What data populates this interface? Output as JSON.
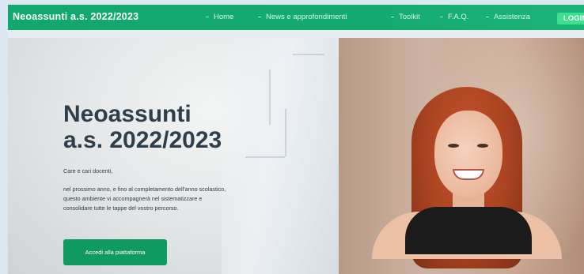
{
  "header": {
    "brand": "Neoassunti a.s. 2022/2023",
    "nav": [
      "Home",
      "News e approfondimenti",
      "Toolkit",
      "F.A.Q.",
      "Assistenza"
    ],
    "login_label": "LOGIN"
  },
  "hero": {
    "title_line1": "Neoassunti",
    "title_line2": "a.s. 2022/2023",
    "greeting": "Care e cari docenti,",
    "body_lines": [
      "nel prossimo anno, e fino al completamento dell'anno  scolastico,",
      "questo ambiente vi accompagnerà nel sistematizzare e",
      "consolidare tutte le tappe del vostro percorso."
    ],
    "cta_label": "Accedi alla piattaforma"
  },
  "colors": {
    "brand_green": "#14a96f",
    "login_bg": "#3ee08f",
    "cta_green": "#119962",
    "heading_text": "#2f3e4c"
  }
}
